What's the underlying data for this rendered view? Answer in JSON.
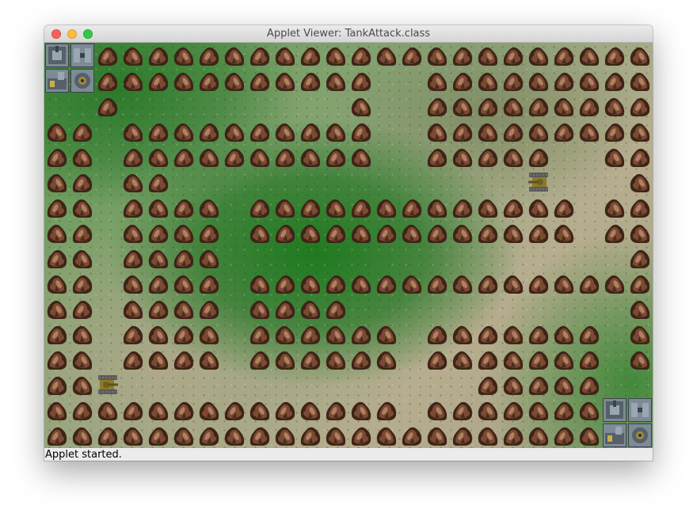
{
  "window": {
    "title": "Applet Viewer: TankAttack.class",
    "status": "Applet started."
  },
  "game": {
    "cols": 24,
    "rows": 16,
    "map": [
      "BB......................",
      "BB......................",
      "...R....................",
      "........................",
      ".............R..........",
      "........................",
      "..........R.............",
      "........................",
      "........................",
      "........................",
      ".......................R",
      "........................",
      "........................",
      ".....R..................",
      "......................BB",
      "......................BB"
    ],
    "rocks": [
      "..RRRRRRRRRRRRRRRRRRRRRR",
      "..RRRRRRRRRRR..RRRRRRRRR",
      "..R.........R..RRRRRRRRR",
      "RR.RRRRRRRRRR..RRRRRRRRR",
      "RR.RRRRRRRRRR..RRRRR..RR",
      "RR.RR..................R",
      "RR.RRRR.RRRRRRRRRRRRR.RR",
      "RR.RRRR.RRRRRRRRRRRRR.RR",
      "RR.RRRR................R",
      "RR.RRRR.RRRRRRRRRRRRRRRR",
      "RR.RRRR.RRRR...........R",
      "RR.RRRR.RRRRRR.RRRRRRR.R",
      "RR.RRRR.RRRRRR.RRRRRRR.R",
      "RR...............RRRRR..",
      "RRRRRRRRRRRRRR.RRRRRRR..",
      "RRRRRRRRRRRRRRRRRRRRRR.."
    ],
    "tanks": [
      {
        "player": "enemy",
        "col": 19,
        "row": 5,
        "facing": "left"
      },
      {
        "player": "player",
        "col": 2,
        "row": 13,
        "facing": "right"
      }
    ],
    "bases": [
      {
        "team": "top-left",
        "col": 0,
        "row": 0
      },
      {
        "team": "bottom-right",
        "col": 22,
        "row": 14
      }
    ],
    "colors": {
      "rock_dark": "#3e2417",
      "rock_mid": "#7b4a33",
      "rock_light": "#b98a6a",
      "tank_body": "#8a7a2a",
      "tank_track": "#5a5a5a",
      "base_metal": "#7e8a96"
    }
  }
}
